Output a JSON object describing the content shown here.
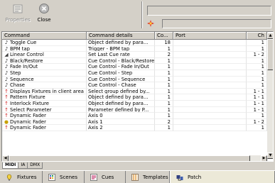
{
  "toolbar": {
    "properties_label": "Properties",
    "close_label": "Close"
  },
  "grid": {
    "columns": [
      "Command",
      "Command details",
      "Co...",
      "Port",
      "Ch"
    ],
    "rows": [
      {
        "icon": "music-note-icon",
        "command": "Toggle Cue",
        "details": "Object defined by para...",
        "count": "18",
        "ch": "1"
      },
      {
        "icon": "music-note-icon",
        "command": "BPM tap",
        "details": "Trigger - BPM tap",
        "count": "1",
        "ch": "1"
      },
      {
        "icon": "ramp-icon",
        "command": "Linear Control",
        "details": "Set Last Cue rate",
        "count": "2",
        "ch": "1 - 2"
      },
      {
        "icon": "music-note-icon",
        "command": "Black/Restore",
        "details": "Cue Control - Black/Restore",
        "count": "1",
        "ch": "1"
      },
      {
        "icon": "music-note-icon",
        "command": "Fade In/Out",
        "details": "Cue Control - Fade In/Out",
        "count": "1",
        "ch": "1"
      },
      {
        "icon": "music-note-icon",
        "command": "Step",
        "details": "Cue Control - Step",
        "count": "1",
        "ch": "1"
      },
      {
        "icon": "music-note-icon",
        "command": "Sequence",
        "details": "Cue Control - Sequence",
        "count": "1",
        "ch": "1"
      },
      {
        "icon": "music-note-icon",
        "command": "Chase",
        "details": "Cue Control - Chase",
        "count": "1",
        "ch": "1"
      },
      {
        "icon": "pin-icon",
        "command": "Displays Fixtures in client area",
        "details": "Select group defined by...",
        "count": "1",
        "ch": "1 - 1"
      },
      {
        "icon": "pin-icon",
        "command": "Pattern Fixture",
        "details": "Object defined by para...",
        "count": "1",
        "ch": "1 - 1"
      },
      {
        "icon": "pin-icon",
        "command": "Interlock Fixture",
        "details": "Object defined by para...",
        "count": "1",
        "ch": "1 - 1"
      },
      {
        "icon": "pin-icon",
        "command": "Select Parameter",
        "details": "Parameter defined by P...",
        "count": "1",
        "ch": "1 - 1"
      },
      {
        "icon": "pin-icon",
        "command": "Dynamic Fader",
        "details": "Axis 0",
        "count": "1",
        "ch": "1"
      },
      {
        "icon": "bulb-icon",
        "command": "Dynamic Fader",
        "details": "Axis 1",
        "count": "2",
        "ch": "1 - 2"
      },
      {
        "icon": "pin-icon",
        "command": "Dynamic Fader",
        "details": "Axis 2",
        "count": "1",
        "ch": "1"
      }
    ]
  },
  "subtabs": [
    "MIDI",
    "IA",
    "DMX"
  ],
  "bottom_tabs": [
    {
      "label": "Fixtures",
      "icon": "fixtures-icon"
    },
    {
      "label": "Scenes",
      "icon": "scenes-icon"
    },
    {
      "label": "Cues",
      "icon": "cues-icon"
    },
    {
      "label": "Templates",
      "icon": "templates-icon"
    },
    {
      "label": "Patch",
      "icon": "patch-icon",
      "active": true
    }
  ],
  "colors": {
    "window_bg": "#d4d0c8",
    "pin_red": "#d02020"
  }
}
